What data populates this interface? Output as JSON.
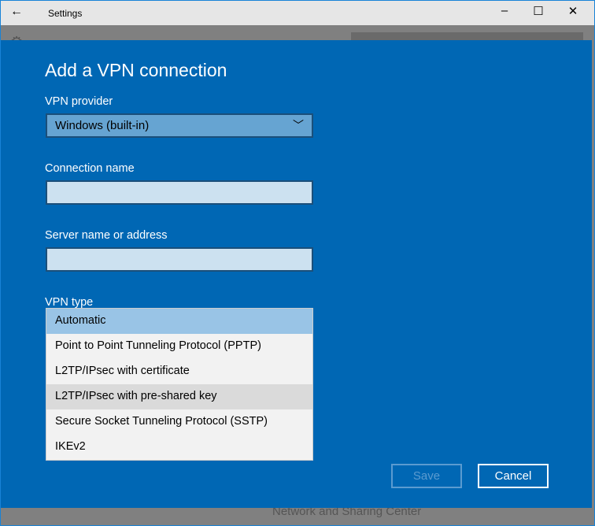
{
  "window": {
    "title": "Settings",
    "minimize": "–",
    "maximize": "☐",
    "close": "✕"
  },
  "background": {
    "link": "Network and Sharing Center"
  },
  "dialog": {
    "heading": "Add a VPN connection",
    "provider_label": "VPN provider",
    "provider_value": "Windows (built-in)",
    "connection_label": "Connection name",
    "connection_value": "",
    "server_label": "Server name or address",
    "server_value": "",
    "type_label": "VPN type",
    "type_options": [
      "Automatic",
      "Point to Point Tunneling Protocol (PPTP)",
      "L2TP/IPsec with certificate",
      "L2TP/IPsec with pre-shared key",
      "Secure Socket Tunneling Protocol (SSTP)",
      "IKEv2"
    ],
    "save": "Save",
    "cancel": "Cancel"
  },
  "colors": {
    "accent": "#0067b4"
  }
}
